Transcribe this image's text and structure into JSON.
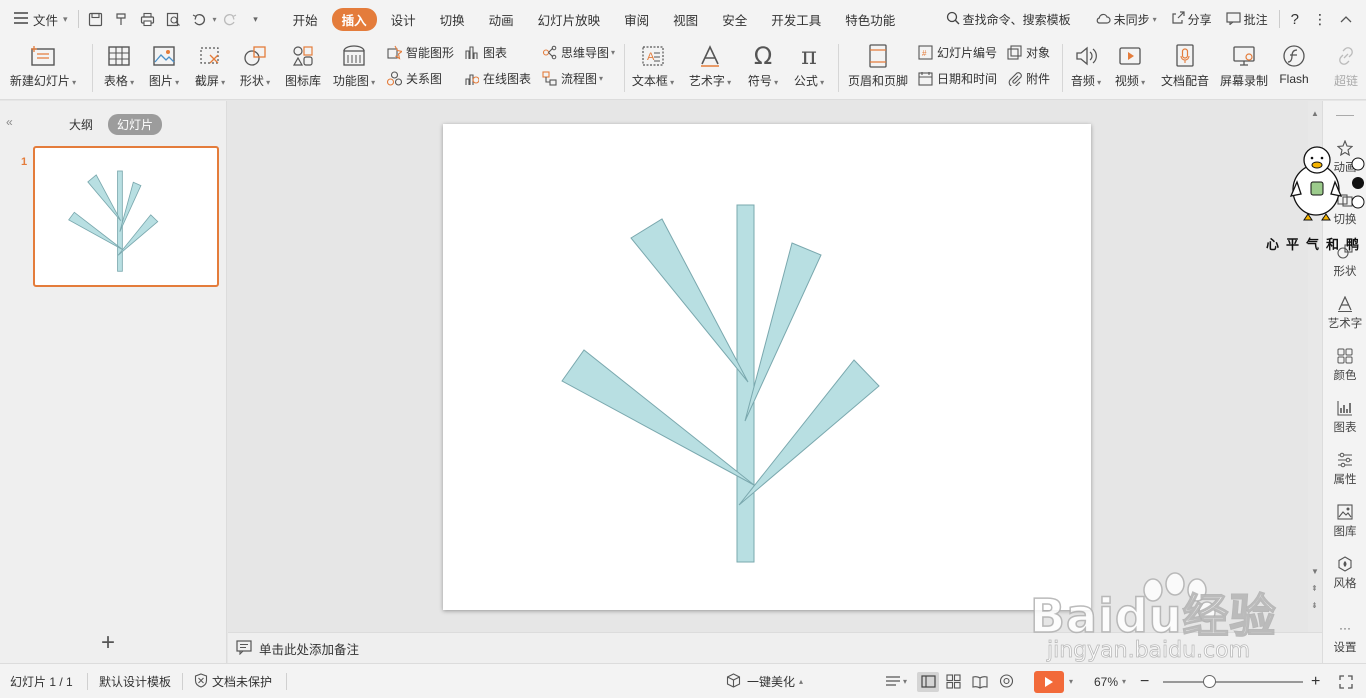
{
  "menubar": {
    "file_label": "文件",
    "tabs": [
      {
        "label": "开始",
        "active": false
      },
      {
        "label": "插入",
        "active": true
      },
      {
        "label": "设计",
        "active": false
      },
      {
        "label": "切换",
        "active": false
      },
      {
        "label": "动画",
        "active": false
      },
      {
        "label": "幻灯片放映",
        "active": false
      },
      {
        "label": "审阅",
        "active": false
      },
      {
        "label": "视图",
        "active": false
      },
      {
        "label": "安全",
        "active": false
      },
      {
        "label": "开发工具",
        "active": false
      },
      {
        "label": "特色功能",
        "active": false
      }
    ],
    "search_placeholder": "查找命令、搜索模板",
    "sync_label": "未同步",
    "share_label": "分享",
    "comment_label": "批注",
    "help_label": "?"
  },
  "ribbon": {
    "new_slide": "新建幻灯片",
    "table": "表格",
    "picture": "图片",
    "screenshot": "截屏",
    "shape": "形状",
    "icon_library": "图标库",
    "function_chart": "功能图",
    "smart_graphic": "智能图形",
    "chart": "图表",
    "relation_chart": "关系图",
    "online_chart": "在线图表",
    "mind_map": "思维导图",
    "flowchart": "流程图",
    "text_box": "文本框",
    "art_text": "艺术字",
    "symbol": "符号",
    "formula": "公式",
    "header_footer": "页眉和页脚",
    "slide_number": "幻灯片编号",
    "object": "对象",
    "date_time": "日期和时间",
    "attachment": "附件",
    "audio": "音频",
    "video": "视频",
    "doc_dubbing": "文档配音",
    "screen_record": "屏幕录制",
    "flash": "Flash",
    "hyperlink": "超链"
  },
  "left_panel": {
    "outline_tab": "大纲",
    "slides_tab": "幻灯片",
    "slide_number": "1",
    "add_icon": "+"
  },
  "notes": {
    "placeholder": "单击此处添加备注"
  },
  "side_panel": [
    {
      "label": "动画",
      "icon": "star-icon"
    },
    {
      "label": "切换",
      "icon": "transition-icon"
    },
    {
      "label": "形状",
      "icon": "shape-icon"
    },
    {
      "label": "艺术字",
      "icon": "art-text-icon"
    },
    {
      "label": "颜色",
      "icon": "color-icon"
    },
    {
      "label": "图表",
      "icon": "chart-icon"
    },
    {
      "label": "属性",
      "icon": "property-icon"
    },
    {
      "label": "图库",
      "icon": "gallery-icon"
    },
    {
      "label": "风格",
      "icon": "style-icon"
    },
    {
      "label": "设置",
      "icon": "settings-icon"
    }
  ],
  "statusbar": {
    "slide_info": "幻灯片 1 / 1",
    "template": "默认设计模板",
    "protection": "文档未保护",
    "beautify": "一键美化",
    "zoom": "67%",
    "zoom_value_fraction": 0.33
  },
  "watermarks": {
    "duck_text": "心平气和鸭",
    "baidu_text": "Baidu经验",
    "baidu_url": "jingyan.baidu.com"
  },
  "colors": {
    "accent": "#E47C3B",
    "shape_fill": "#B8DFE2",
    "shape_stroke": "#7AA8AE",
    "play": "#F26A3A"
  }
}
